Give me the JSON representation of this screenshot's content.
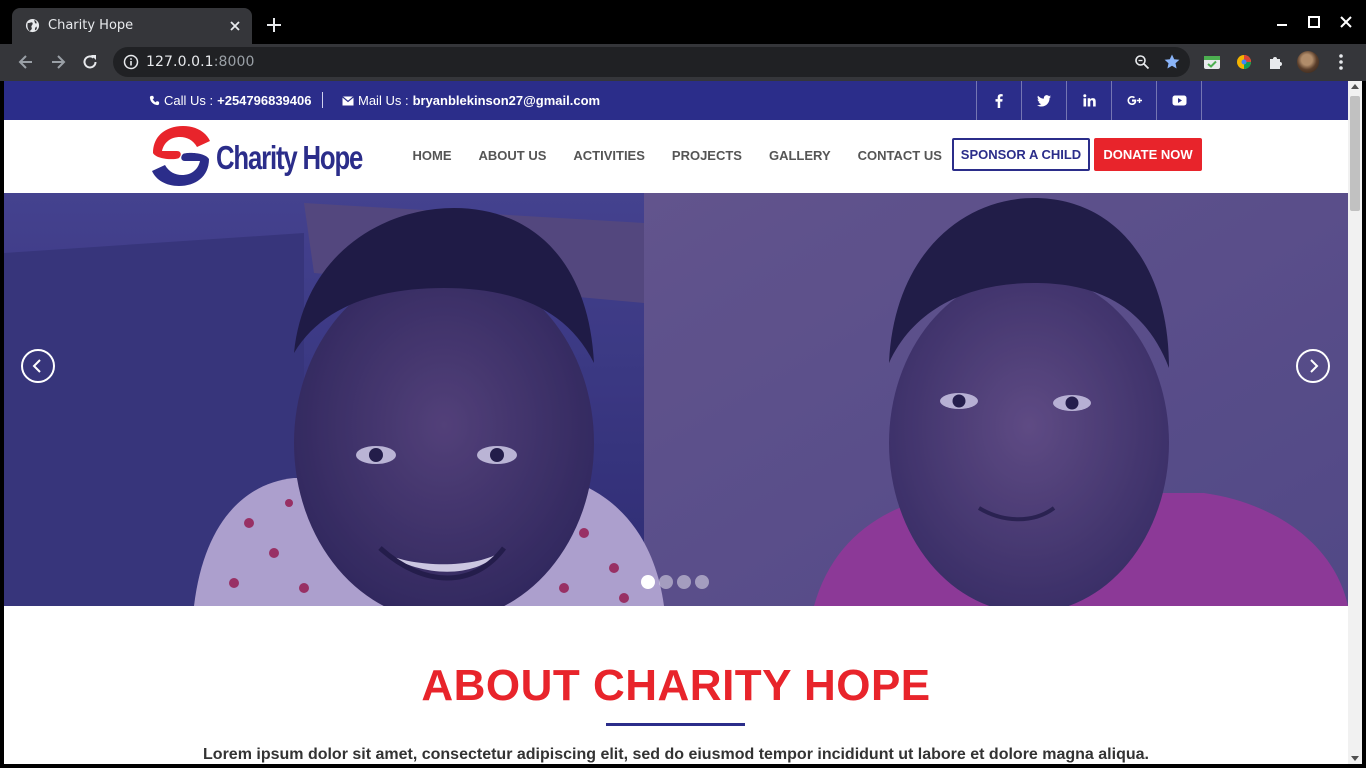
{
  "browser": {
    "tab_title": "Charity Hope",
    "url_host": "127.0.0.1",
    "url_port": ":8000",
    "bookmarked": true
  },
  "topbar": {
    "call_label": "Call Us :",
    "phone": "+254796839406",
    "mail_label": "Mail Us :",
    "email": "bryanblekinson27@gmail.com",
    "social_icons": [
      "facebook-icon",
      "twitter-icon",
      "linkedin-icon",
      "google-plus-icon",
      "youtube-icon"
    ]
  },
  "header": {
    "logo_text": "Charity Hope",
    "nav": [
      "HOME",
      "ABOUT US",
      "ACTIVITIES",
      "PROJECTS",
      "GALLERY",
      "CONTACT US"
    ],
    "sponsor_label": "SPONSOR A CHILD",
    "donate_label": "DONATE NOW"
  },
  "hero": {
    "slide_count": 4,
    "active_slide": 1
  },
  "about": {
    "title": "ABOUT CHARITY HOPE",
    "text": "Lorem ipsum dolor sit amet, consectetur adipiscing elit, sed do eiusmod tempor incididunt ut labore et dolore magna aliqua."
  },
  "colors": {
    "brand_blue": "#2b2d8a",
    "brand_red": "#e8242b",
    "chrome_dark": "#35363a"
  }
}
